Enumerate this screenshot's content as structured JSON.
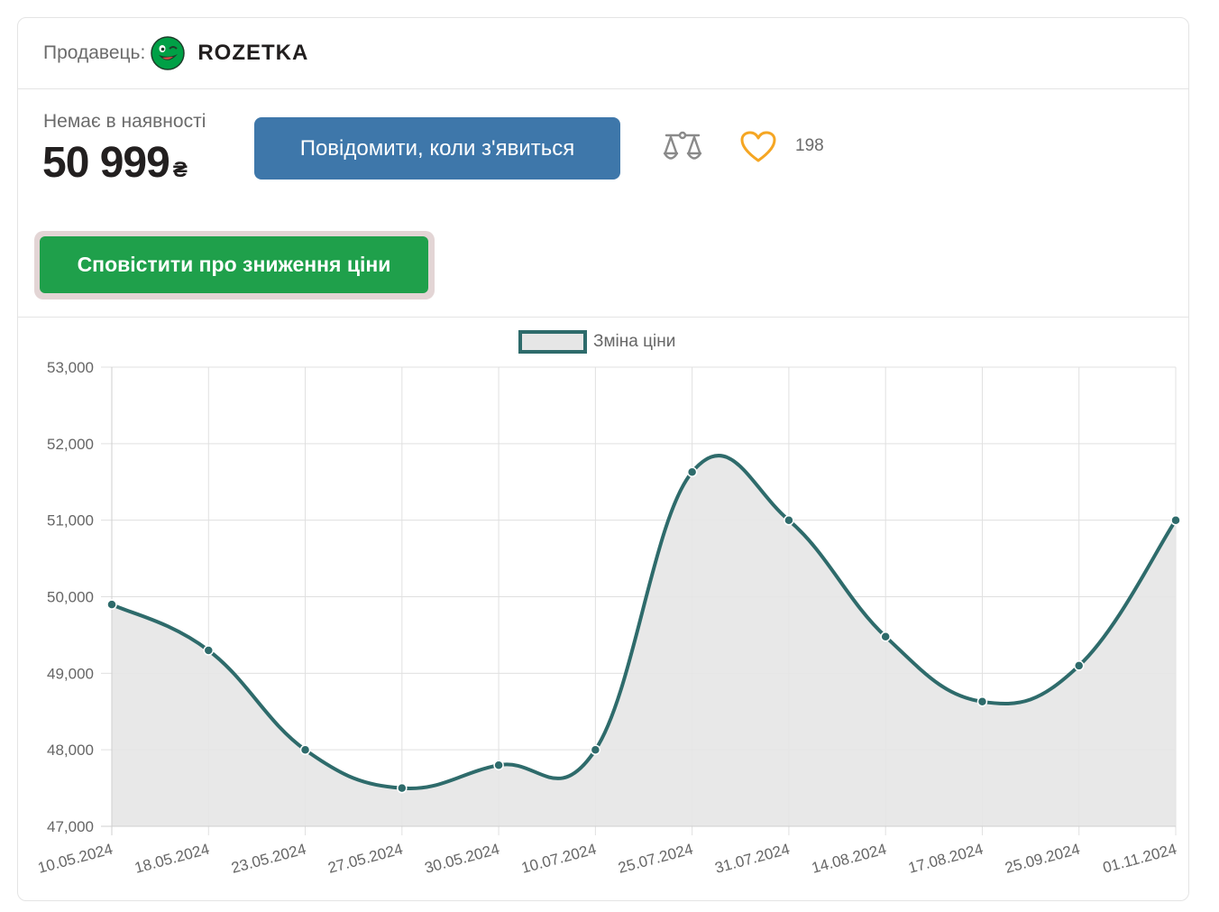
{
  "seller": {
    "label": "Продавець:",
    "logo_icon": "rozetka-smiley-icon",
    "name": "ROZETKA"
  },
  "buy": {
    "availability": "Немає в наявності",
    "price": "50 999",
    "currency": "₴",
    "notify_label": "Повідомити, коли з'явиться",
    "compare_icon": "scales-icon",
    "wishlist_icon": "heart-icon",
    "wishlist_count": "198"
  },
  "price_alert": {
    "label": "Сповістити про зниження ціни"
  },
  "colors": {
    "notify_button": "#3e77aa",
    "alert_button": "#1fa04b",
    "chart_line": "#2e6b6b",
    "chart_fill": "#e6e6e6",
    "heart": "#f5a623"
  },
  "chart_data": {
    "type": "line",
    "legend": "Зміна ціни",
    "legend_position": "top",
    "grid": true,
    "categories": [
      "10.05.2024",
      "18.05.2024",
      "23.05.2024",
      "27.05.2024",
      "30.05.2024",
      "10.07.2024",
      "25.07.2024",
      "31.07.2024",
      "14.08.2024",
      "17.08.2024",
      "25.09.2024",
      "01.11.2024"
    ],
    "values": [
      49899,
      49299,
      47999,
      47499,
      47799,
      47999,
      51629,
      50999,
      49479,
      48629,
      49099,
      50999
    ],
    "ylim": [
      47000,
      53000
    ],
    "yticks": [
      "47,000",
      "48,000",
      "49,000",
      "50,000",
      "51,000",
      "52,000",
      "53,000"
    ]
  }
}
